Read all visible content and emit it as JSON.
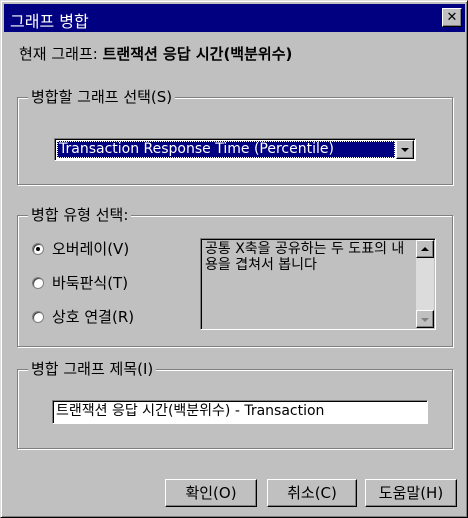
{
  "window": {
    "title": "그래프 병합",
    "close_glyph": "✕"
  },
  "current_graph": {
    "label": "현재 그래프:",
    "value": "트랜잭션 응답 시간(백분위수)"
  },
  "select_group": {
    "label": "병합할 그래프 선택(S)",
    "selected_value": "Transaction Response Time (Percentile)"
  },
  "merge_type_group": {
    "label": "병합 유형 선택:",
    "options": [
      {
        "label": "오버레이(V)",
        "checked": true
      },
      {
        "label": "바둑판식(T)",
        "checked": false
      },
      {
        "label": "상호 연결(R)",
        "checked": false
      }
    ],
    "description": "공통 X축을 공유하는 두 도표의 내용을 겹쳐서 봅니다"
  },
  "title_group": {
    "label": "병합 그래프 제목(I)",
    "value": "트랜잭션 응답 시간(백분위수) - Transaction"
  },
  "buttons": {
    "ok": "확인(O)",
    "cancel": "취소(C)",
    "help": "도움말(H)"
  },
  "colors": {
    "face": "#c0c0c0",
    "title_bar": "#000080",
    "selection": "#000080"
  }
}
